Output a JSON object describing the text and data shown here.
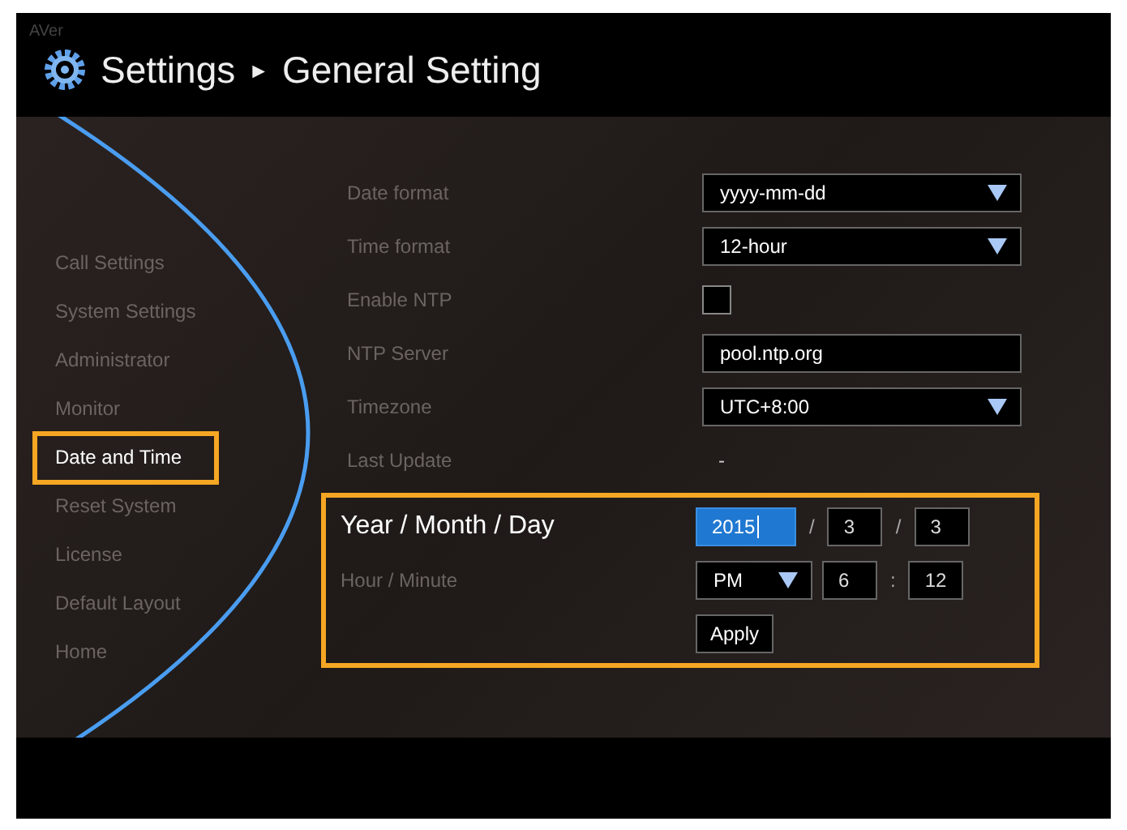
{
  "header": {
    "logo": "AVer",
    "breadcrumb": [
      "Settings",
      "General Setting"
    ],
    "separator": "►"
  },
  "sidebar": {
    "items": [
      {
        "label": "Call Settings",
        "selected": false
      },
      {
        "label": "System Settings",
        "selected": false
      },
      {
        "label": "Administrator",
        "selected": false
      },
      {
        "label": "Monitor",
        "selected": false
      },
      {
        "label": "Date and Time",
        "selected": true
      },
      {
        "label": "Reset System",
        "selected": false
      },
      {
        "label": "License",
        "selected": false
      },
      {
        "label": "Default Layout",
        "selected": false
      },
      {
        "label": "Home",
        "selected": false
      }
    ]
  },
  "form": {
    "rows": [
      {
        "label": "Date format",
        "kind": "select",
        "value": "yyyy-mm-dd"
      },
      {
        "label": "Time format",
        "kind": "select",
        "value": "12-hour"
      },
      {
        "label": "Enable NTP",
        "kind": "checkbox",
        "checked": false
      },
      {
        "label": "NTP Server",
        "kind": "text",
        "value": "pool.ntp.org"
      },
      {
        "label": "Timezone",
        "kind": "select",
        "value": "UTC+8:00"
      },
      {
        "label": "Last Update",
        "kind": "static",
        "value": "-"
      }
    ]
  },
  "date_time": {
    "highlighted": true,
    "rows": [
      {
        "label": "Year / Month / Day",
        "active": true,
        "items": [
          {
            "kind": "field",
            "value": "2015",
            "focused": true
          },
          {
            "kind": "sep",
            "text": "/"
          },
          {
            "kind": "field",
            "value": "3",
            "focused": false
          },
          {
            "kind": "sep",
            "text": "/"
          },
          {
            "kind": "field",
            "value": "3",
            "focused": false
          }
        ]
      },
      {
        "label": "Hour / Minute",
        "active": false,
        "items": [
          {
            "kind": "select",
            "value": "PM"
          },
          {
            "kind": "field",
            "value": "6",
            "focused": false
          },
          {
            "kind": "sep",
            "text": ":"
          },
          {
            "kind": "field",
            "value": "12",
            "focused": false
          }
        ]
      }
    ],
    "apply_button": "Apply"
  }
}
